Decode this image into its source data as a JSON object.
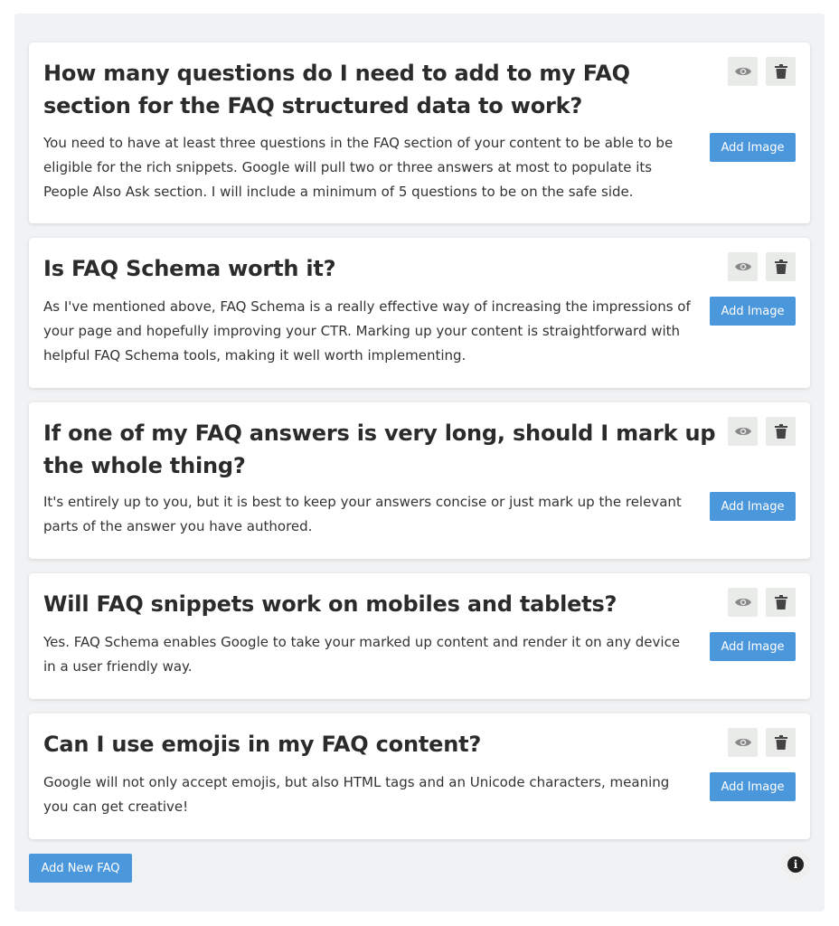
{
  "faqs": [
    {
      "question": "How many questions do I need to add to my FAQ section for the FAQ structured data to work?",
      "answer": "You need to have at least three questions in the FAQ section of your content to be able to be eligible for the rich snippets. Google will pull two or three answers at most to populate its People Also Ask section. I will include a minimum of 5 questions to be on the safe side.",
      "add_image_label": "Add Image"
    },
    {
      "question": "Is FAQ Schema worth it?",
      "answer": "As I've mentioned above, FAQ Schema is a really effective way of increasing the impressions of your page and hopefully improving your CTR. Marking up your content is straightforward with helpful FAQ Schema tools, making it well worth implementing.",
      "add_image_label": "Add Image"
    },
    {
      "question": "If one of my FAQ answers is very long, should I mark up the whole thing?",
      "answer": "It's entirely up to  you, but it is best to keep your answers concise or just mark up the relevant parts of the answer you have authored.",
      "add_image_label": "Add Image"
    },
    {
      "question": "Will FAQ snippets work on mobiles and tablets?",
      "answer": "Yes. FAQ Schema enables Google to take your marked up content and render it on any device in a user friendly way.",
      "add_image_label": "Add Image"
    },
    {
      "question": "Can I use emojis in my FAQ content?",
      "answer": "Google will not only accept emojis, but also HTML tags and an Unicode characters, meaning you can get creative!",
      "add_image_label": "Add Image"
    }
  ],
  "add_new_faq_label": "Add New FAQ",
  "icons": {
    "view": "eye-icon",
    "delete": "trash-icon",
    "info": "info-icon"
  },
  "colors": {
    "accent": "#4a97db",
    "panel_bg": "#f1f2f3",
    "icon_button_bg": "#e9ebe9"
  }
}
